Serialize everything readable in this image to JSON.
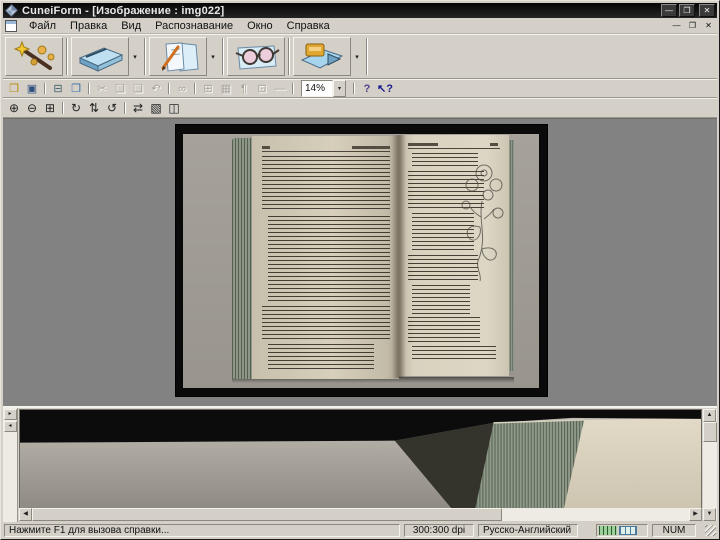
{
  "window": {
    "title": "CuneiForm - [Изображение : img022]",
    "controls": {
      "minimize": "—",
      "maximize": "❐",
      "close": "✕"
    }
  },
  "menu": {
    "items": [
      {
        "name": "menu-file",
        "label": "Файл"
      },
      {
        "name": "menu-edit",
        "label": "Правка"
      },
      {
        "name": "menu-view",
        "label": "Вид"
      },
      {
        "name": "menu-recognition",
        "label": "Распознавание"
      },
      {
        "name": "menu-window",
        "label": "Окно"
      },
      {
        "name": "menu-help",
        "label": "Справка"
      }
    ],
    "mdi_controls": {
      "minimize": "—",
      "restore": "❐",
      "close": "✕"
    }
  },
  "toolbar_main": {
    "dropdown_glyph": "▾",
    "buttons": [
      {
        "name": "wizard-button",
        "icon": "magic-wand-icon"
      },
      {
        "name": "scan-button",
        "icon": "scanner-icon",
        "has_dropdown": true
      },
      {
        "name": "recognize-button",
        "icon": "recognize-page-icon",
        "has_dropdown": true
      },
      {
        "name": "verify-button",
        "icon": "glasses-icon"
      },
      {
        "name": "export-button",
        "icon": "export-save-icon",
        "has_dropdown": true
      }
    ]
  },
  "toolbar_std": {
    "items": [
      {
        "name": "open-button",
        "icon": "open-folder-icon",
        "glyph": "❒",
        "color": "#b8860b",
        "enabled": true
      },
      {
        "name": "save-button",
        "icon": "save-floppy-icon",
        "glyph": "▣",
        "color": "#2f4f7f",
        "enabled": true
      },
      {
        "type": "sep"
      },
      {
        "name": "print-button",
        "icon": "printer-icon",
        "glyph": "⊟",
        "color": "#40606a",
        "enabled": true
      },
      {
        "name": "preview-button",
        "icon": "page-preview-icon",
        "glyph": "❐",
        "color": "#3a6ea5",
        "enabled": true
      },
      {
        "type": "sep"
      },
      {
        "name": "cut-button",
        "icon": "scissors-icon",
        "glyph": "✂",
        "enabled": false
      },
      {
        "name": "copy-button",
        "icon": "copy-icon",
        "glyph": "❏",
        "enabled": false
      },
      {
        "name": "paste-button",
        "icon": "paste-icon",
        "glyph": "❑",
        "enabled": false
      },
      {
        "name": "undo-button",
        "icon": "undo-icon",
        "glyph": "↶",
        "enabled": false
      },
      {
        "type": "sep"
      },
      {
        "name": "find-button",
        "icon": "binoculars-icon",
        "glyph": "∞",
        "enabled": false
      },
      {
        "type": "sep"
      },
      {
        "name": "table-button",
        "icon": "table-icon",
        "glyph": "⊞",
        "enabled": false
      },
      {
        "name": "cells-button",
        "icon": "cells-grid-icon",
        "glyph": "▦",
        "enabled": false
      },
      {
        "name": "pilcrow-button",
        "icon": "pilcrow-icon",
        "glyph": "¶",
        "enabled": false
      },
      {
        "name": "picture-button",
        "icon": "picture-frame-icon",
        "glyph": "⊡",
        "enabled": false
      },
      {
        "name": "hline-button",
        "icon": "horizontal-line-icon",
        "glyph": "—",
        "enabled": false
      }
    ],
    "zoom_combo": {
      "value": "14%",
      "dropdown_glyph": "▾"
    },
    "help_items": [
      {
        "name": "help-button",
        "icon": "help-icon",
        "glyph": "?",
        "color": "#5a3c8c",
        "enabled": true
      },
      {
        "name": "context-help-button",
        "icon": "context-help-icon",
        "glyph": "↖?",
        "color": "#1a1a8c",
        "enabled": true
      }
    ]
  },
  "toolbar_image": {
    "items": [
      {
        "name": "zoom-in-button",
        "icon": "zoom-in-icon",
        "glyph": "⊕",
        "enabled": true
      },
      {
        "name": "zoom-out-button",
        "icon": "zoom-out-icon",
        "glyph": "⊖",
        "enabled": true
      },
      {
        "name": "fit-page-button",
        "icon": "fit-page-icon",
        "glyph": "⊞",
        "enabled": true
      },
      {
        "type": "sep"
      },
      {
        "name": "rotate-right-button",
        "icon": "rotate-right-icon",
        "glyph": "↻",
        "enabled": true
      },
      {
        "name": "rotate-180-button",
        "icon": "rotate-180-icon",
        "glyph": "⇅",
        "enabled": true
      },
      {
        "name": "rotate-left-button",
        "icon": "rotate-left-icon",
        "glyph": "↺",
        "enabled": true
      },
      {
        "type": "sep"
      },
      {
        "name": "flip-button",
        "icon": "flip-horizontal-icon",
        "glyph": "⇄",
        "enabled": true
      },
      {
        "name": "select-area-button",
        "icon": "select-area-icon",
        "glyph": "▧",
        "enabled": true
      },
      {
        "name": "zoom-window-button",
        "icon": "zoom-window-icon",
        "glyph": "◫",
        "enabled": true
      }
    ]
  },
  "zoom_panel": {
    "splitter_buttons": [
      {
        "name": "zoom-panel-expand-button",
        "glyph": "▸"
      },
      {
        "name": "zoom-panel-collapse-button",
        "glyph": "◂"
      }
    ],
    "scroll_glyphs": {
      "up": "▲",
      "down": "▼",
      "left": "◀",
      "right": "▶"
    }
  },
  "statusbar": {
    "message": "Нажмите F1 для вызова справки...",
    "dpi": "300:300 dpi",
    "language": "Русско-Английский",
    "keyboard": "NUM"
  },
  "colors": {
    "chrome": "#d4d0c8",
    "titlebar": "#0d0d0d",
    "canvas_bg": "#828282",
    "scan_bg": "#a19d96",
    "page_cream": "#d8d1bd",
    "page_stack_green": "#6e7a6e",
    "zoom_panel_black": "#0c0c0c"
  }
}
